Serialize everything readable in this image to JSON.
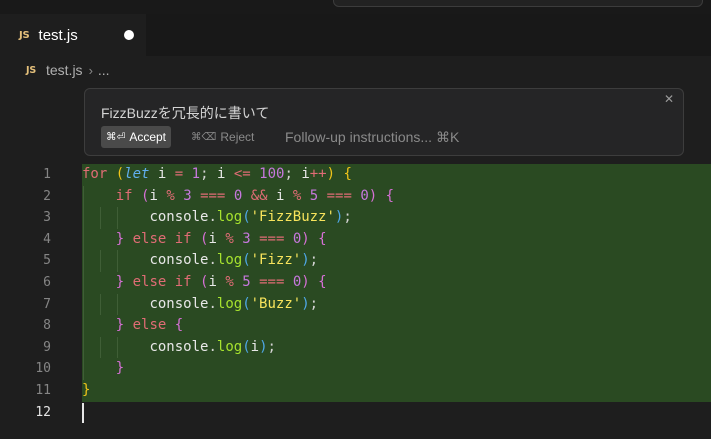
{
  "tab": {
    "icon": "js-file-icon",
    "icon_text": "JS",
    "title": "test.js",
    "modified": true
  },
  "breadcrumb": {
    "icon_text": "JS",
    "file": "test.js",
    "more": "..."
  },
  "inline_chat": {
    "prompt": "FizzBuzzを冗長的に書いて",
    "accept_shortcut": "⌘⏎",
    "accept_label": "Accept",
    "reject_shortcut": "⌘⌫",
    "reject_label": "Reject",
    "followup_placeholder": "Follow-up instructions... ⌘K"
  },
  "editor": {
    "line_numbers": [
      "1",
      "2",
      "3",
      "4",
      "5",
      "6",
      "7",
      "8",
      "9",
      "10",
      "11",
      "12"
    ],
    "active_line": "12",
    "lines": [
      "for (let i = 1; i <= 100; i++) {",
      "    if (i % 3 === 0 && i % 5 === 0) {",
      "        console.log('FizzBuzz');",
      "    } else if (i % 3 === 0) {",
      "        console.log('Fizz');",
      "    } else if (i % 5 === 0) {",
      "        console.log('Buzz');",
      "    } else {",
      "        console.log(i);",
      "    }",
      "}",
      ""
    ]
  },
  "colors": {
    "added_line_bg": "#2a4a22",
    "editor_bg": "#1e1e1e",
    "accent_keyword": "#e06c75",
    "string": "#f8e45c"
  }
}
